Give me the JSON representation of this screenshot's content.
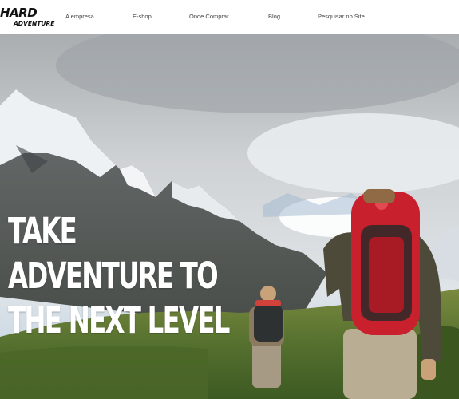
{
  "brand": {
    "name": "HARD",
    "tagline": "ADVENTURE"
  },
  "nav": [
    {
      "label": "A empresa"
    },
    {
      "label": "E-shop"
    },
    {
      "label": "Onde Comprar"
    },
    {
      "label": "Blog"
    },
    {
      "label": "Pesquisar no Site"
    }
  ],
  "hero": {
    "headline_lines": [
      "TAKE",
      "ADVENTURE TO",
      "THE NEXT LEVEL"
    ]
  },
  "colors": {
    "header_bg": "#ffffff",
    "headline": "#ffffff",
    "backpack_red": "#c8202c"
  }
}
